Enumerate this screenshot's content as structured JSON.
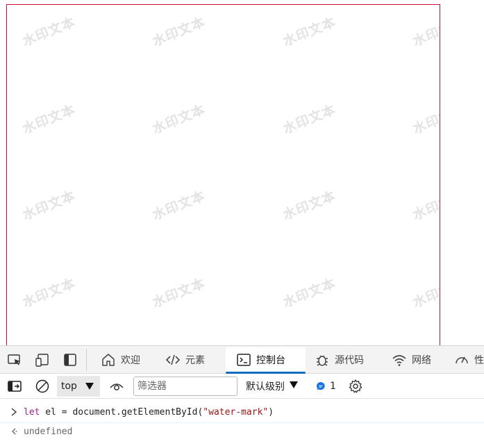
{
  "viewport": {
    "border_color": "#c8102e",
    "watermark_text": "水印文本"
  },
  "devtools": {
    "tabs": [
      {
        "label": "欢迎",
        "icon": "home-icon"
      },
      {
        "label": "元素",
        "icon": "code-icon"
      },
      {
        "label": "控制台",
        "icon": "console-icon",
        "active": true
      },
      {
        "label": "源代码",
        "icon": "bug-icon"
      },
      {
        "label": "网络",
        "icon": "wifi-icon"
      },
      {
        "label": "性",
        "icon": "gauge-icon"
      }
    ],
    "accent": "#0f6cbd",
    "toolbar": {
      "context": "top",
      "filter_placeholder": "筛选器",
      "level": "默认级别",
      "message_count": "1"
    },
    "console": {
      "input": {
        "keyword": "let",
        "var": " el = document.getElementById(",
        "string": "\"water-mark\"",
        "close": ")"
      },
      "output": "undefined"
    }
  }
}
